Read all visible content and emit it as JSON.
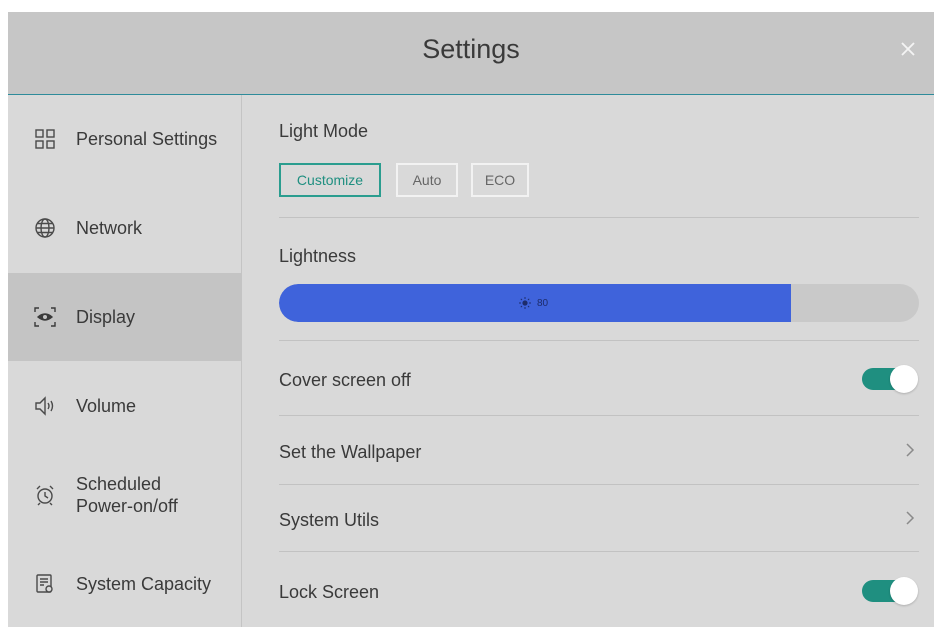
{
  "window": {
    "title": "Settings"
  },
  "sidebar": {
    "items": [
      {
        "label": "Personal Settings",
        "icon": "grid-icon"
      },
      {
        "label": "Network",
        "icon": "globe-icon"
      },
      {
        "label": "Display",
        "icon": "display-eye-icon",
        "active": true
      },
      {
        "label": "Volume",
        "icon": "speaker-icon"
      },
      {
        "label": "Scheduled\nPower-on/off",
        "icon": "alarm-clock-icon"
      },
      {
        "label": "System Capacity",
        "icon": "storage-icon"
      }
    ]
  },
  "display": {
    "light_mode": {
      "title": "Light Mode",
      "options": [
        "Customize",
        "Auto",
        "ECO"
      ],
      "selected": "Customize"
    },
    "lightness": {
      "title": "Lightness",
      "value": "80",
      "fraction": 0.8,
      "icon": "sun-icon"
    },
    "cover_screen_off": {
      "label": "Cover screen off",
      "on": true
    },
    "wallpaper": {
      "label": "Set the Wallpaper"
    },
    "system_utils": {
      "label": "System Utils"
    },
    "lock_screen": {
      "label": "Lock Screen",
      "on": true
    }
  },
  "colors": {
    "accent_teal": "#1f8f80",
    "slider_blue": "#3f63db"
  }
}
